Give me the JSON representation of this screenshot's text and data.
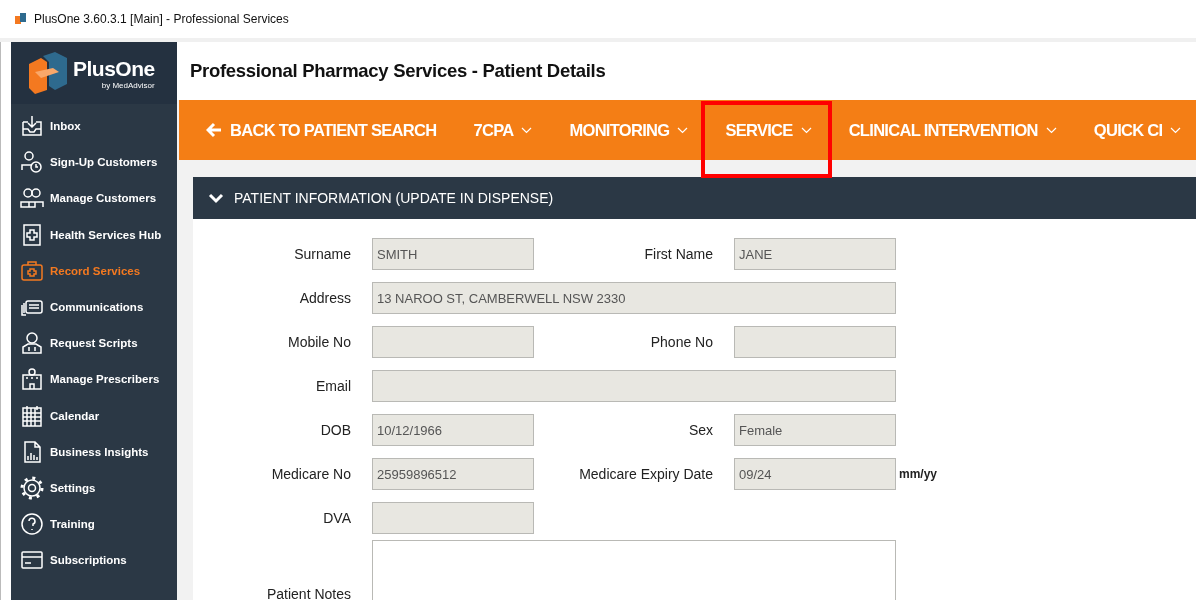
{
  "window": {
    "title": "PlusOne 3.60.3.1 [Main] - Professional Services"
  },
  "brand": {
    "name": "PlusOne",
    "tagline": "by MedAdvisor"
  },
  "sidebar": {
    "items": [
      {
        "label": "Inbox",
        "selected": false
      },
      {
        "label": "Sign-Up Customers",
        "selected": false
      },
      {
        "label": "Manage Customers",
        "selected": false
      },
      {
        "label": "Health Services Hub",
        "selected": false
      },
      {
        "label": "Record Services",
        "selected": true
      },
      {
        "label": "Communications",
        "selected": false
      },
      {
        "label": "Request Scripts",
        "selected": false
      },
      {
        "label": "Manage Prescribers",
        "selected": false
      },
      {
        "label": "Calendar",
        "selected": false
      },
      {
        "label": "Business Insights",
        "selected": false
      },
      {
        "label": "Settings",
        "selected": false
      },
      {
        "label": "Training",
        "selected": false
      },
      {
        "label": "Subscriptions",
        "selected": false
      }
    ]
  },
  "page_title": "Professional Pharmacy Services - Patient Details",
  "toolbar": {
    "items": [
      {
        "label": "BACK TO PATIENT SEARCH",
        "kind": "back",
        "highlighted": false
      },
      {
        "label": "7CPA",
        "kind": "menu",
        "highlighted": false
      },
      {
        "label": "MONITORING",
        "kind": "menu",
        "highlighted": false
      },
      {
        "label": "SERVICE",
        "kind": "menu",
        "highlighted": true
      },
      {
        "label": "CLINICAL INTERVENTION",
        "kind": "menu",
        "highlighted": false
      },
      {
        "label": "QUICK CI",
        "kind": "menu",
        "highlighted": false
      }
    ]
  },
  "panel": {
    "title": "PATIENT INFORMATION (UPDATE IN DISPENSE)",
    "expanded": true,
    "rows": [
      {
        "fields": [
          {
            "label": "Surname",
            "value": "SMITH",
            "kind": "short"
          },
          {
            "label": "First Name",
            "value": "JANE",
            "kind": "short"
          }
        ]
      },
      {
        "fields": [
          {
            "label": "Address",
            "value": "13 NAROO ST, CAMBERWELL NSW 2330",
            "kind": "wide"
          }
        ]
      },
      {
        "fields": [
          {
            "label": "Mobile No",
            "kind": "short"
          },
          {
            "label": "Phone No",
            "kind": "short"
          }
        ]
      },
      {
        "fields": [
          {
            "label": "Email",
            "kind": "wide"
          }
        ]
      },
      {
        "fields": [
          {
            "label": "DOB",
            "value": "10/12/1966",
            "kind": "short"
          },
          {
            "label": "Sex",
            "value": "Female",
            "kind": "short"
          }
        ]
      },
      {
        "fields": [
          {
            "label": "Medicare No",
            "value": "25959896512",
            "kind": "short"
          },
          {
            "label": "Medicare Expiry Date",
            "value": "09/24",
            "kind": "short",
            "suffix": "mm/yy"
          }
        ]
      },
      {
        "fields": [
          {
            "label": "DVA",
            "kind": "short"
          }
        ]
      },
      {
        "fields": [
          {
            "label": "Patient Notes",
            "kind": "notes"
          }
        ]
      }
    ]
  }
}
